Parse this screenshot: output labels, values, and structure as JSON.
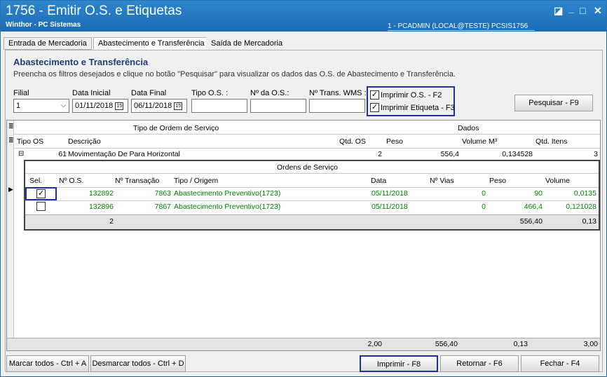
{
  "window": {
    "title": "1756 - Emitir O.S. e Etiquetas",
    "subtitle": "Winthor - PC Sistemas",
    "session": "1 - PCADMIN (LOCAL@TESTE)  PCSIS1756",
    "controls": [
      "◪",
      "_",
      "□",
      "✕"
    ]
  },
  "tabs": [
    "Entrada de Mercadoria",
    "Abastecimento e Transferência",
    "Saída de Mercadoria"
  ],
  "section": {
    "title": "Abastecimento e Transferência",
    "description": "Preencha os filtros desejados e clique no botão \"Pesquisar\" para visualizar os dados das O.S. de Abastecimento e Transferência."
  },
  "filters": {
    "filial_label": "Filial",
    "filial_value": "1",
    "data_inicial_label": "Data Inicial",
    "data_inicial_value": "01/11/2018",
    "data_final_label": "Data Final",
    "data_final_value": "06/11/2018",
    "tipo_os_label": "Tipo O.S. :",
    "num_os_label": "Nº da O.S.:",
    "num_trans_label": "Nº Trans. WMS :",
    "calendar_glyph": "15",
    "check_os_label": "Imprimir O.S. - F2",
    "check_etiqueta_label": "Imprimir Etiqueta - F3",
    "pesquisar": "Pesquisar - F9"
  },
  "grid": {
    "group_header_tipo": "Tipo de Ordem de Serviço",
    "group_header_dados": "Dados",
    "columns": [
      "Tipo OS",
      "Descrição",
      "Qtd. OS",
      "Peso",
      "Volume M³",
      "Qtd. Itens"
    ],
    "row": {
      "expander": "⊟",
      "tipo": "61",
      "descricao": "Movimentação De Para Horizontal",
      "qtd_os": "2",
      "peso": "556,4",
      "volume": "0,134528",
      "itens": "3"
    },
    "detail_title": "Ordens de Serviço",
    "detail_columns": [
      "Sel.",
      "Nº O.S.",
      "Nº Transação",
      "Tipo / Origem",
      "Data",
      "Nº Vias",
      "Peso",
      "Volume"
    ],
    "detail_rows": [
      {
        "sel": true,
        "os": "132892",
        "transacao": "7863",
        "tipo": "Abastecimento Preventivo(1723)",
        "data": "05/11/2018",
        "vias": "0",
        "peso": "90",
        "volume": "0,0135"
      },
      {
        "sel": false,
        "os": "132896",
        "transacao": "7867",
        "tipo": "Abastecimento Preventivo(1723)",
        "data": "05/11/2018",
        "vias": "0",
        "peso": "466,4",
        "volume": "0,121028"
      }
    ],
    "detail_footer": {
      "count": "2",
      "peso": "556,40",
      "volume": "0,13"
    },
    "footer": {
      "qtd_os": "2,00",
      "peso": "556,40",
      "volume": "0,13",
      "itens": "3,00"
    }
  },
  "buttons": {
    "marcar": "Marcar todos - Ctrl + A",
    "desmarcar": "Desmarcar todos - Ctrl + D",
    "imprimir": "Imprimir - F8",
    "retornar": "Retornar - F6",
    "fechar": "Fechar - F4"
  },
  "checkmark": "✓"
}
